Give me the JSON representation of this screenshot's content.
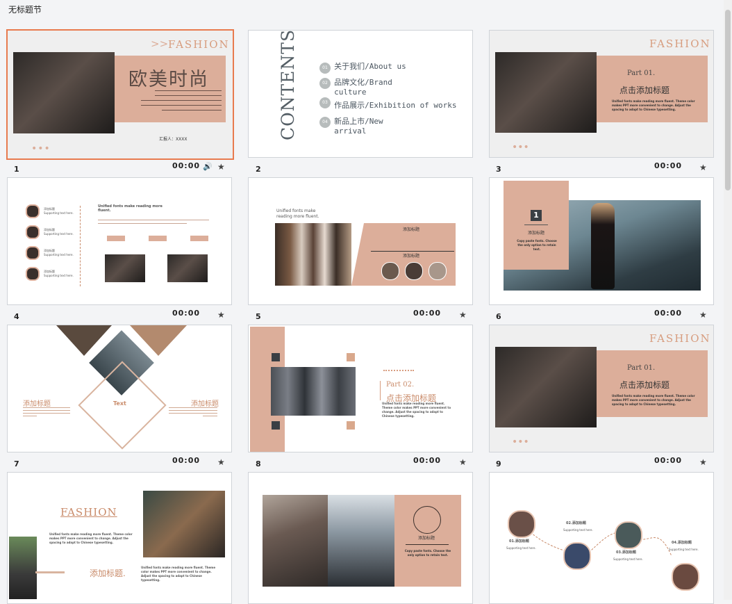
{
  "section": {
    "title": "无标题节"
  },
  "colors": {
    "accent": "#e87a4e",
    "tan": "#dcae9a",
    "brown": "#c98b6a"
  },
  "slides": [
    {
      "number": "1",
      "time": "00:00"
    },
    {
      "number": "2"
    },
    {
      "number": "3",
      "time": "00:00"
    },
    {
      "number": "4",
      "time": "00:00"
    },
    {
      "number": "5",
      "time": "00:00"
    },
    {
      "number": "6",
      "time": "00:00"
    },
    {
      "number": "7",
      "time": "00:00"
    },
    {
      "number": "8",
      "time": "00:00"
    },
    {
      "number": "9",
      "time": "00:00"
    }
  ],
  "s1": {
    "fashion": "FASHION",
    "title": "欧美时尚",
    "reporter": "汇报人：XXXX"
  },
  "s2": {
    "contents": "CONTENTS",
    "items": [
      {
        "n": "01",
        "text": "关于我们/About us"
      },
      {
        "n": "02",
        "text": "品牌文化/Brand culture"
      },
      {
        "n": "03",
        "text": "作品展示/Exhibition of works"
      },
      {
        "n": "04",
        "text": "新品上市/New arrival"
      }
    ]
  },
  "s3": {
    "fashion": "FASHION",
    "part": "Part 01.",
    "title": "点击添加标题",
    "body": "Unified fonts make reading more fluent. Theme color makes PPT more convenient to change. Adjust the spacing to adapt to Chinese typesetting."
  },
  "s4": {
    "heading": "Unified fonts make reading more fluent.",
    "item_label": "添加标题",
    "item_sub": "Supporting text here."
  },
  "s5": {
    "heading": "Unified fonts make reading more fluent.",
    "t1": "添加标题",
    "t2": "添加标题"
  },
  "s6": {
    "badge": "1",
    "label": "添加标题",
    "body": "Copy paste fonts. Choose the only option to retain text."
  },
  "s7": {
    "left": "添加标题",
    "right": "添加标题",
    "center": "Text"
  },
  "s8": {
    "part": "Part 02.",
    "title": "点击添加标题",
    "body": "Unified fonts make reading more fluent. Theme color makes PPT more convenient to change. Adjust the spacing to adapt to Chinese typesetting."
  },
  "s9": {
    "fashion": "FASHION",
    "part": "Part 01.",
    "title": "点击添加标题",
    "body": "Unified fonts make reading more fluent. Theme color makes PPT more convenient to change. Adjust the spacing to adapt to Chinese typesetting."
  },
  "s10": {
    "fashion": "FASHION",
    "title": "添加标题.",
    "body": "Unified fonts make reading more fluent. Theme color makes PPT more convenient to change. Adjust the spacing to adapt to Chinese typesetting."
  },
  "s11": {
    "label": "添加标题",
    "body": "Copy paste fonts. Choose the only option to retain text."
  },
  "s12": {
    "labels": [
      "01.添加标题",
      "02.添加标题",
      "03.添加标题",
      "04.添加标题"
    ],
    "sub": "Supporting text here."
  }
}
